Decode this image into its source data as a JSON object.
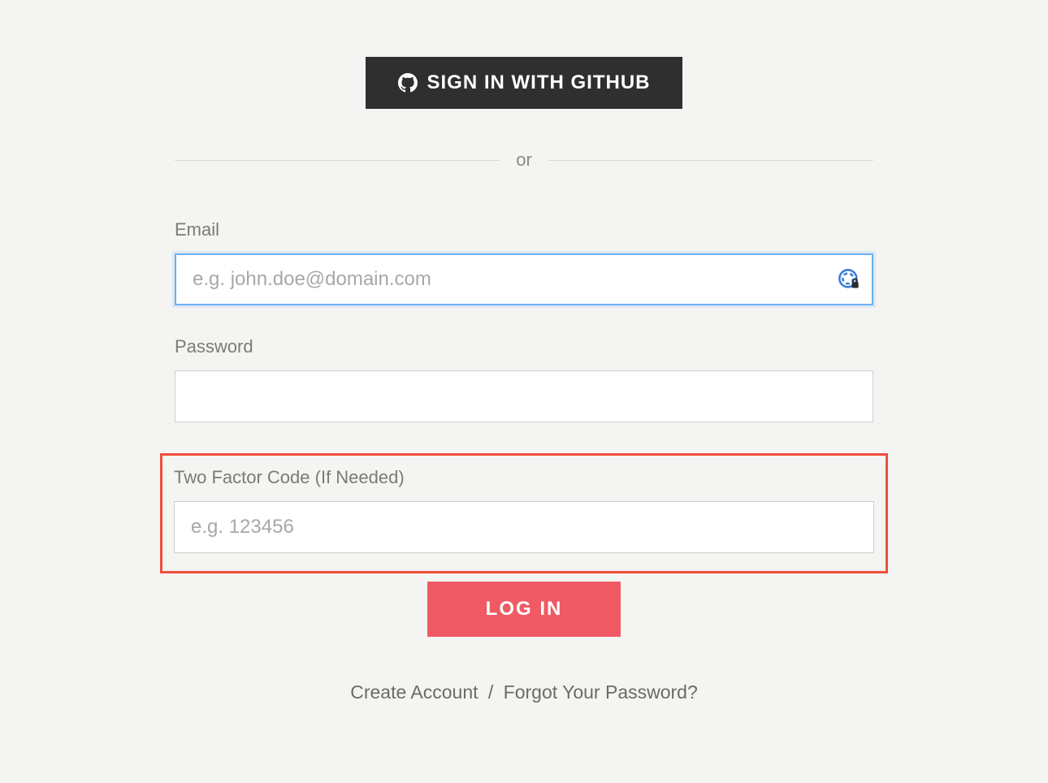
{
  "oauth": {
    "github_label": "SIGN IN WITH GITHUB"
  },
  "divider": {
    "text": "or"
  },
  "form": {
    "email": {
      "label": "Email",
      "placeholder": "e.g. john.doe@domain.com",
      "value": ""
    },
    "password": {
      "label": "Password",
      "placeholder": "",
      "value": ""
    },
    "two_factor": {
      "label": "Two Factor Code (If Needed)",
      "placeholder": "e.g. 123456",
      "value": ""
    },
    "submit_label": "LOG IN"
  },
  "footer": {
    "create_account": "Create Account",
    "separator": "/",
    "forgot_password": "Forgot Your Password?"
  }
}
